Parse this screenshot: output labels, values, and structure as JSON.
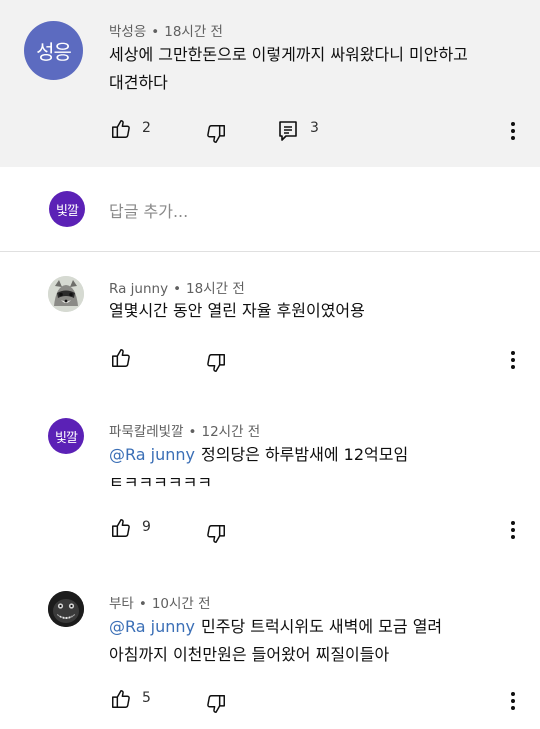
{
  "top_comment": {
    "avatar_text": "성응",
    "author": "박성응",
    "time": "18시간 전",
    "text_line1": "세상에 그만한돈으로 이렇게까지 싸워왔다니 미안하고",
    "text_line2": "대견하다",
    "likes": "2",
    "replies": "3"
  },
  "reply_box": {
    "avatar_text": "빛깔",
    "placeholder": "답글 추가..."
  },
  "replies": [
    {
      "author": "Ra junny",
      "time": "18시간 전",
      "line1": "열몇시간 동안 열린 자율 후원이였어용"
    },
    {
      "avatar_text": "빛깔",
      "author": "파묵칼레빛깔",
      "time": "12시간 전",
      "mention": "@Ra junny",
      "line1": "정의당은 하루밤새에 12억모임",
      "line2": "ㅌㅋㅋㅋㅋㅋㅋ",
      "likes": "9"
    },
    {
      "author": "부타",
      "time": "10시간 전",
      "mention": "@Ra junny",
      "line1": "민주당 트럭시위도 새벽에 모금 열려",
      "line2": "아침까지 이천만원은 들어왔어 찌질이들아",
      "likes": "5"
    }
  ],
  "separator": "•"
}
